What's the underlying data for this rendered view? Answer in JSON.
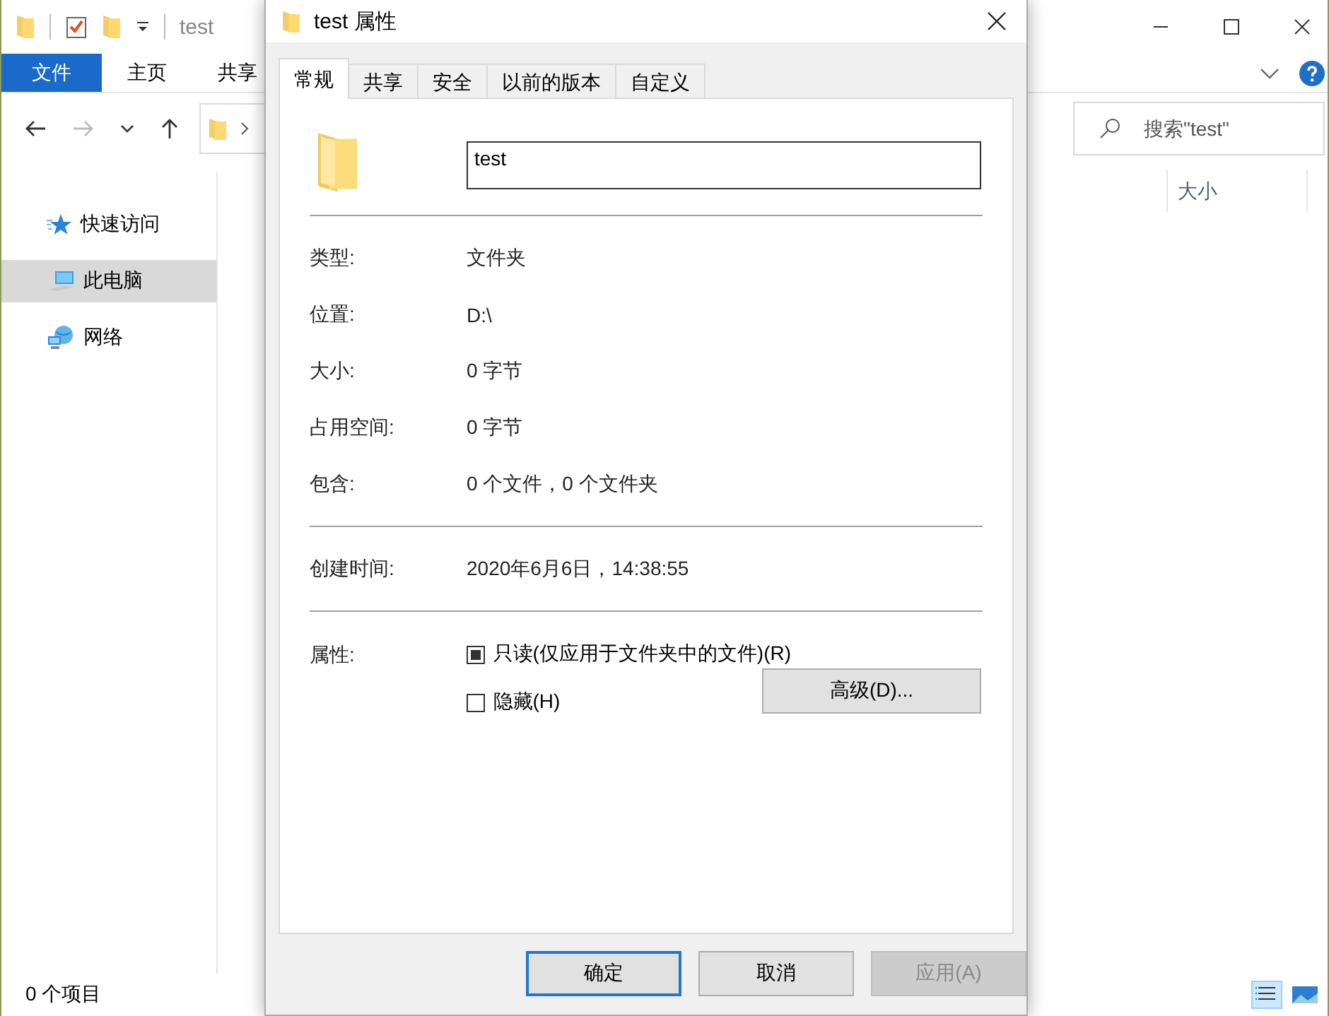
{
  "explorer": {
    "title": "test",
    "ribbon_tabs": [
      {
        "label": "文件",
        "kind": "file"
      },
      {
        "label": "主页",
        "kind": "tab"
      },
      {
        "label": "共享",
        "kind": "tab"
      }
    ],
    "search": {
      "placeholder": "搜索\"test\""
    },
    "nav_items": [
      {
        "label": "快速访问",
        "kind": "star",
        "selected": false
      },
      {
        "label": "此电脑",
        "kind": "computer",
        "selected": true
      },
      {
        "label": "网络",
        "kind": "network",
        "selected": false
      }
    ],
    "columns": [
      "大小"
    ],
    "status_bar": "0 个项目"
  },
  "dialog": {
    "title": "test 属性",
    "tabs": [
      {
        "label": "常规",
        "selected": true
      },
      {
        "label": "共享",
        "selected": false
      },
      {
        "label": "安全",
        "selected": false
      },
      {
        "label": "以前的版本",
        "selected": false
      },
      {
        "label": "自定义",
        "selected": false
      }
    ],
    "name": "test",
    "sections": [
      [
        {
          "label": "类型:",
          "value": "文件夹"
        },
        {
          "label": "位置:",
          "value": "D:\\"
        },
        {
          "label": "大小:",
          "value": "0 字节"
        },
        {
          "label": "占用空间:",
          "value": "0 字节"
        },
        {
          "label": "包含:",
          "value": "0 个文件，0 个文件夹"
        }
      ],
      [
        {
          "label": "创建时间:",
          "value": "2020年6月6日，14:38:55"
        }
      ]
    ],
    "attributes_label": "属性:",
    "attributes": [
      {
        "label": "只读(仅应用于文件夹中的文件)(R)",
        "checked": false,
        "indeterminate": true
      },
      {
        "label": "隐藏(H)",
        "checked": false,
        "indeterminate": false
      }
    ],
    "advanced_button": "高级(D)...",
    "buttons": [
      {
        "label": "确定",
        "default": true,
        "disabled": false
      },
      {
        "label": "取消",
        "default": false,
        "disabled": false
      },
      {
        "label": "应用(A)",
        "default": false,
        "disabled": true
      }
    ]
  }
}
